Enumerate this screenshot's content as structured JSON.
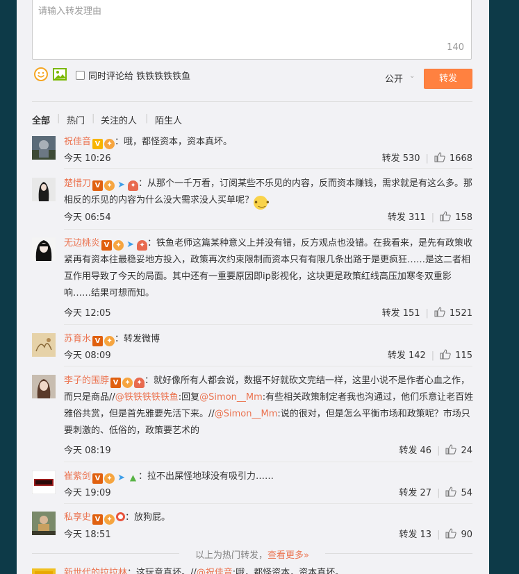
{
  "composer": {
    "placeholder": "请输入转发理由",
    "char_count": "140",
    "also_comment_label": "同时评论给 铁铁铁铁铁鱼",
    "visibility": "公开",
    "forward_button": "转发"
  },
  "tabs": [
    "全部",
    "热门",
    "关注的人",
    "陌生人"
  ],
  "reposts": [
    {
      "user": "祝佳音",
      "text_parts": [
        {
          "t": "：哦，都怪资本，资本真坏。"
        }
      ],
      "time": "今天 10:26",
      "forwards": "转发 530",
      "likes": "1668"
    },
    {
      "user": "楚惜刀",
      "text_parts": [
        {
          "t": "：从那个一千万看，订阅某些不乐见的内容，反而资本赚钱，需求就是有这么多。那相反的乐见的内容为什么没大需求没人买单呢？"
        }
      ],
      "time": "今天 06:54",
      "forwards": "转发 311",
      "likes": "158"
    },
    {
      "user": "无边桃炎",
      "text_parts": [
        {
          "t": "：铁鱼老师这篇某种意义上并没有错，反方观点也没错。在我看来，是先有政策收紧再有资本往最稳妥地方投入，政策再次约束限制而资本只有有限几条出路于是更疯狂……是这二者相互作用导致了今天的局面。其中还有一重要原因即ip影视化，这块更是政策红线高压加寒冬双重影响……结果可想而知。"
        }
      ],
      "time": "今天 12:05",
      "forwards": "转发 151",
      "likes": "1521"
    },
    {
      "user": "苏育水",
      "text_parts": [
        {
          "t": "：转发微博"
        }
      ],
      "time": "今天 08:09",
      "forwards": "转发 142",
      "likes": "115"
    },
    {
      "user": "李子的围脖",
      "text_parts": [
        {
          "t": "：就好像所有人都会说，数据不好就砍文完结一样，这里小说不是作者心血之作，而只是商品//"
        },
        {
          "l": "@铁铁铁铁铁鱼"
        },
        {
          "t": ":回复"
        },
        {
          "l": "@Simon__Mm"
        },
        {
          "t": ":有些相关政策制定者我也沟通过，他们乐意让老百姓雅俗共赏，但是首先雅要先活下来。//"
        },
        {
          "l": "@Simon__Mm"
        },
        {
          "t": ":说的很对，但是怎么平衡市场和政策呢？市场只要刺激的、低俗的，政策要艺术的"
        }
      ],
      "time": "今天 08:19",
      "forwards": "转发 46",
      "likes": "24"
    },
    {
      "user": "崔紫剑",
      "text_parts": [
        {
          "t": "：拉不出屎怪地球没有吸引力……"
        }
      ],
      "time": "今天 19:09",
      "forwards": "转发 27",
      "likes": "54"
    },
    {
      "user": "私享史",
      "text_parts": [
        {
          "t": "：放狗屁。"
        }
      ],
      "time": "今天 18:51",
      "forwards": "转发 13",
      "likes": "90"
    }
  ],
  "hot_footer": {
    "text": "以上为热门转发，",
    "more": "查看更多»"
  },
  "cutoff": {
    "user": "新世代的拉拉林",
    "text1": "：这玩意真坏。//",
    "mention": "@祝佳音",
    "text2": ":哦，都怪资本，资本真坏。"
  },
  "colors": {
    "accent": "#eb7350",
    "button": "#ff8140",
    "background": "#0d3a48",
    "panel": "#f2f2f5"
  }
}
